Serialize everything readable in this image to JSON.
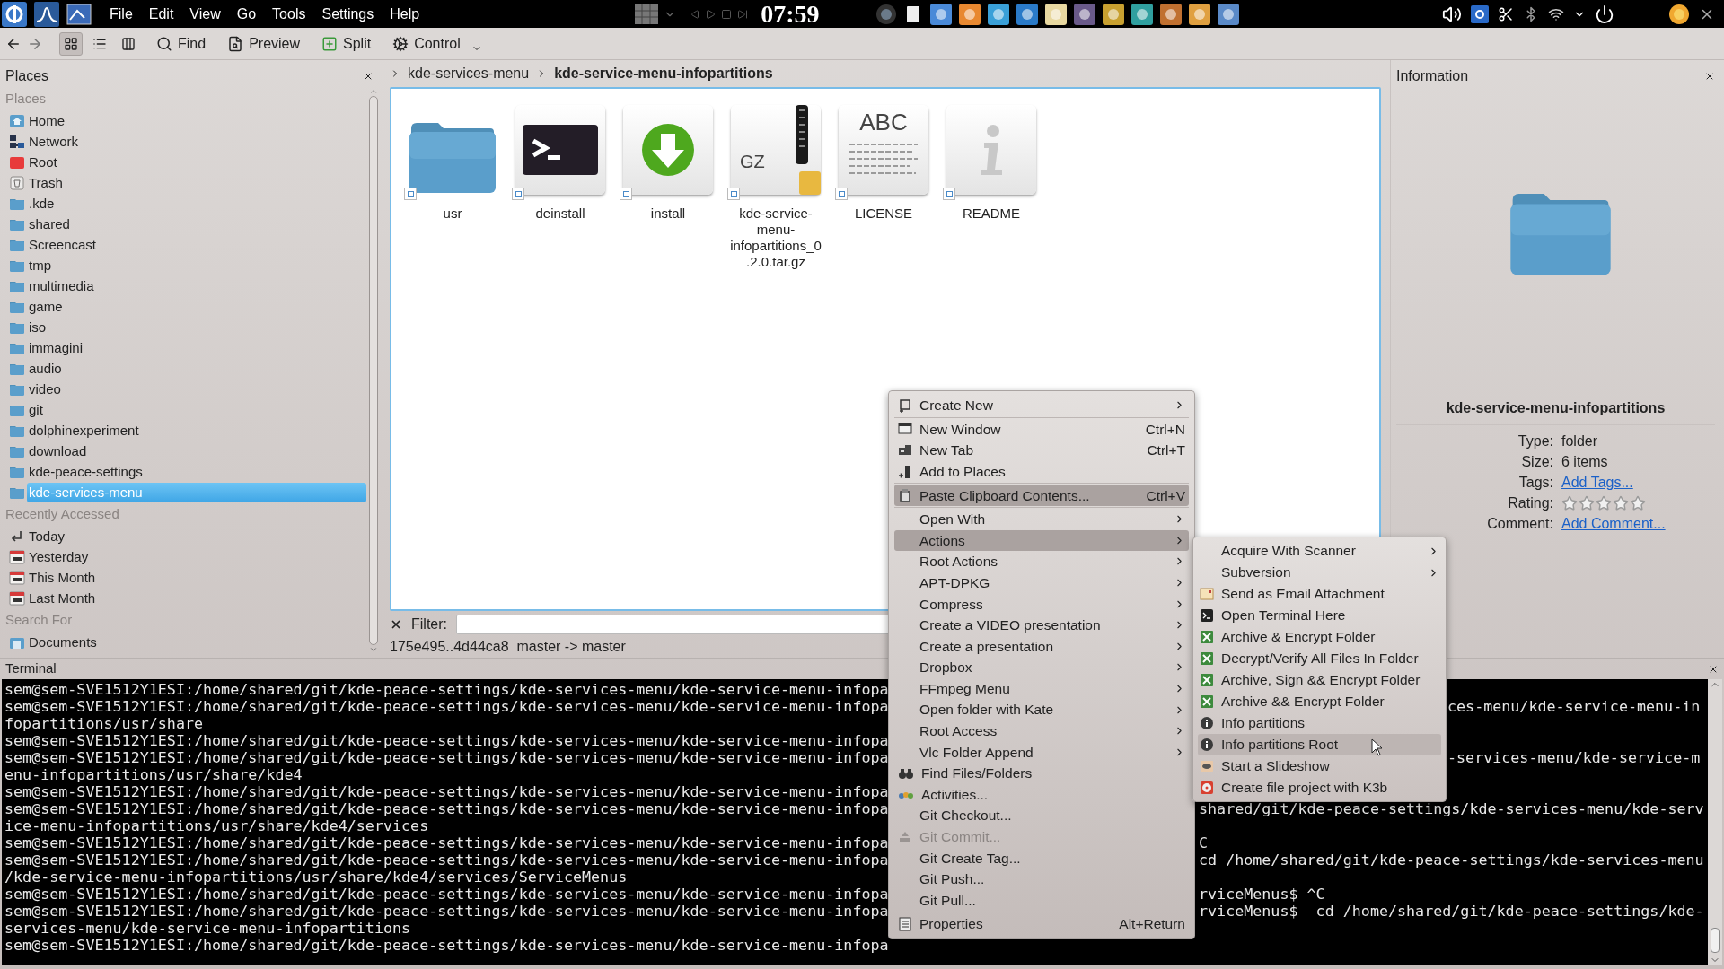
{
  "top_panel": {
    "menu": [
      "File",
      "Edit",
      "View",
      "Go",
      "Tools",
      "Settings",
      "Help"
    ],
    "clock": "07:59"
  },
  "toolbar": {
    "view_modes": [
      {
        "kind": "icons",
        "selected": true
      },
      {
        "kind": "details",
        "selected": false
      },
      {
        "kind": "columns",
        "selected": false
      }
    ],
    "buttons": [
      {
        "kind": "find",
        "label": "Find"
      },
      {
        "kind": "preview",
        "label": "Preview"
      },
      {
        "kind": "split",
        "label": "Split"
      },
      {
        "kind": "control",
        "label": "Control"
      }
    ]
  },
  "places": {
    "title": "Places",
    "sections": [
      {
        "heading": "Places",
        "items": [
          {
            "label": "Home",
            "kind": "home",
            "selected": false
          },
          {
            "label": "Network",
            "kind": "network",
            "selected": false
          },
          {
            "label": "Root",
            "kind": "root",
            "selected": false
          },
          {
            "label": "Trash",
            "kind": "trash",
            "selected": false
          },
          {
            "label": ".kde",
            "kind": "folder",
            "selected": false
          },
          {
            "label": "shared",
            "kind": "folder",
            "selected": false
          },
          {
            "label": "Screencast",
            "kind": "folder",
            "selected": false
          },
          {
            "label": "tmp",
            "kind": "folder",
            "selected": false
          },
          {
            "label": "multimedia",
            "kind": "folder",
            "selected": false
          },
          {
            "label": "game",
            "kind": "folder",
            "selected": false
          },
          {
            "label": "iso",
            "kind": "folder",
            "selected": false
          },
          {
            "label": "immagini",
            "kind": "folder",
            "selected": false
          },
          {
            "label": "audio",
            "kind": "folder",
            "selected": false
          },
          {
            "label": "video",
            "kind": "folder",
            "selected": false
          },
          {
            "label": "git",
            "kind": "folder",
            "selected": false
          },
          {
            "label": "dolphinexperiment",
            "kind": "folder",
            "selected": false
          },
          {
            "label": "download",
            "kind": "folder",
            "selected": false
          },
          {
            "label": "kde-peace-settings",
            "kind": "folder",
            "selected": false
          },
          {
            "label": "kde-services-menu",
            "kind": "folder",
            "selected": true
          }
        ]
      },
      {
        "heading": "Recently Accessed",
        "items": [
          {
            "label": "Today",
            "kind": "back",
            "selected": false
          },
          {
            "label": "Yesterday",
            "kind": "calendar",
            "selected": false
          },
          {
            "label": "This Month",
            "kind": "calendar",
            "selected": false
          },
          {
            "label": "Last Month",
            "kind": "calendar",
            "selected": false
          }
        ]
      },
      {
        "heading": "Search For",
        "items": [
          {
            "label": "Documents",
            "kind": "document",
            "selected": false
          }
        ]
      }
    ]
  },
  "breadcrumb": [
    "kde-services-menu",
    "kde-service-menu-infopartitions"
  ],
  "files": [
    {
      "name": "usr",
      "kind": "folder"
    },
    {
      "name": "deinstall",
      "kind": "script"
    },
    {
      "name": "install",
      "kind": "installer"
    },
    {
      "name": "kde-service-menu-infopartitions_0.2.0.tar.gz",
      "kind": "archive",
      "icon_text": "GZ"
    },
    {
      "name": "LICENSE",
      "kind": "text",
      "icon_text": "ABC"
    },
    {
      "name": "README",
      "kind": "info"
    }
  ],
  "filter": {
    "label": "Filter:"
  },
  "status": "175e495..4d44ca8  master -> master",
  "info": {
    "title": "Information",
    "name": "kde-service-menu-infopartitions",
    "properties": [
      {
        "label": "Type:",
        "kind": "text",
        "value": "folder"
      },
      {
        "label": "Size:",
        "kind": "text",
        "value": "6 items"
      },
      {
        "label": "Tags:",
        "kind": "link",
        "value": "Add Tags..."
      },
      {
        "label": "Rating:",
        "kind": "rating",
        "stars": 0
      },
      {
        "label": "Comment:",
        "kind": "link",
        "value": "Add Comment..."
      }
    ]
  },
  "terminal": {
    "title": "Terminal",
    "lines": [
      {
        "left": "sem@sem-SVE1512Y1ESI:/home/shared/git/kde-peace-settings/kde-services-menu/kde-service-menu-infopa"
      },
      {
        "left": "sem@sem-SVE1512Y1ESI:/home/shared/git/kde-peace-settings/kde-services-menu/kde-service-menu-infopa",
        "right": "ces-menu/kde-service-menu-in"
      },
      {
        "left": "fopartitions/usr/share"
      },
      {
        "left": "sem@sem-SVE1512Y1ESI:/home/shared/git/kde-peace-settings/kde-services-menu/kde-service-menu-infopa"
      },
      {
        "left": "sem@sem-SVE1512Y1ESI:/home/shared/git/kde-peace-settings/kde-services-menu/kde-service-menu-infopa",
        "right": "-services-menu/kde-service-m"
      },
      {
        "left": "enu-infopartitions/usr/share/kde4"
      },
      {
        "left": "sem@sem-SVE1512Y1ESI:/home/shared/git/kde-peace-settings/kde-services-menu/kde-service-menu-infopa"
      },
      {
        "left": "sem@sem-SVE1512Y1ESI:/home/shared/git/kde-peace-settings/kde-services-menu/kde-service-menu-infopa",
        "right": "shared/git/kde-peace-settings/kde-services-menu/kde-serv"
      },
      {
        "left": "ice-menu-infopartitions/usr/share/kde4/services"
      },
      {
        "left": "sem@sem-SVE1512Y1ESI:/home/shared/git/kde-peace-settings/kde-services-menu/kde-service-menu-infopa",
        "right": "C"
      },
      {
        "left": "sem@sem-SVE1512Y1ESI:/home/shared/git/kde-peace-settings/kde-services-menu/kde-service-menu-infopa",
        "right": "cd /home/shared/git/kde-peace-settings/kde-services-menu"
      },
      {
        "left": "/kde-service-menu-infopartitions/usr/share/kde4/services/ServiceMenus"
      },
      {
        "left": "sem@sem-SVE1512Y1ESI:/home/shared/git/kde-peace-settings/kde-services-menu/kde-service-menu-infopa",
        "right": "rviceMenus$ ^C"
      },
      {
        "left": "sem@sem-SVE1512Y1ESI:/home/shared/git/kde-peace-settings/kde-services-menu/kde-service-menu-infopa",
        "right": "rviceMenus$  cd /home/shared/git/kde-peace-settings/kde-"
      },
      {
        "left": "services-menu/kde-service-menu-infopartitions"
      },
      {
        "left": "sem@sem-SVE1512Y1ESI:/home/shared/git/kde-peace-settings/kde-services-menu/kde-service-menu-infopa"
      }
    ]
  },
  "menu": {
    "sections": [
      [
        {
          "label": "Create New",
          "kind": "new",
          "submenu": true,
          "highlighted": false,
          "disabled": false
        }
      ],
      [
        {
          "label": "New Window",
          "kind": "window",
          "shortcut": "Ctrl+N",
          "submenu": false,
          "highlighted": false,
          "disabled": false
        },
        {
          "label": "New Tab",
          "kind": "tab",
          "shortcut": "Ctrl+T",
          "submenu": false,
          "highlighted": false,
          "disabled": false
        },
        {
          "label": "Add to Places",
          "kind": "bookmark",
          "submenu": false,
          "highlighted": false,
          "disabled": false
        }
      ],
      [
        {
          "label": "Paste Clipboard Contents...",
          "kind": "paste",
          "shortcut": "Ctrl+V",
          "submenu": false,
          "highlighted": true,
          "disabled": false
        }
      ],
      [
        {
          "label": "Open With",
          "kind": "none",
          "submenu": true,
          "highlighted": false,
          "disabled": false
        },
        {
          "label": "Actions",
          "kind": "none",
          "submenu": true,
          "highlighted": true,
          "disabled": false
        },
        {
          "label": "Root Actions",
          "kind": "none",
          "submenu": true,
          "highlighted": false,
          "disabled": false
        },
        {
          "label": "APT-DPKG",
          "kind": "none",
          "submenu": true,
          "highlighted": false,
          "disabled": false
        },
        {
          "label": "Compress",
          "kind": "none",
          "submenu": true,
          "highlighted": false,
          "disabled": false
        },
        {
          "label": "Create a VIDEO presentation",
          "kind": "none",
          "submenu": true,
          "highlighted": false,
          "disabled": false
        },
        {
          "label": "Create a presentation",
          "kind": "none",
          "submenu": true,
          "highlighted": false,
          "disabled": false
        },
        {
          "label": "Dropbox",
          "kind": "none",
          "submenu": true,
          "highlighted": false,
          "disabled": false
        },
        {
          "label": "FFmpeg Menu",
          "kind": "none",
          "submenu": true,
          "highlighted": false,
          "disabled": false
        },
        {
          "label": "Open folder with Kate",
          "kind": "none",
          "submenu": true,
          "highlighted": false,
          "disabled": false
        },
        {
          "label": "Root Access",
          "kind": "none",
          "submenu": true,
          "highlighted": false,
          "disabled": false
        },
        {
          "label": "Vlc Folder Append",
          "kind": "none",
          "submenu": true,
          "highlighted": false,
          "disabled": false
        },
        {
          "label": "Find Files/Folders",
          "kind": "binoculars",
          "submenu": false,
          "highlighted": false,
          "disabled": false
        },
        {
          "label": "Activities...",
          "kind": "activities",
          "submenu": false,
          "highlighted": false,
          "disabled": false
        },
        {
          "label": "Git Checkout...",
          "kind": "none",
          "submenu": false,
          "highlighted": false,
          "disabled": false
        },
        {
          "label": "Git Commit...",
          "kind": "commit",
          "submenu": false,
          "highlighted": false,
          "disabled": true
        },
        {
          "label": "Git Create Tag...",
          "kind": "none",
          "submenu": false,
          "highlighted": false,
          "disabled": false
        },
        {
          "label": "Git Push...",
          "kind": "none",
          "submenu": false,
          "highlighted": false,
          "disabled": false
        },
        {
          "label": "Git Pull...",
          "kind": "none",
          "submenu": false,
          "highlighted": false,
          "disabled": false
        }
      ],
      [
        {
          "label": "Properties",
          "kind": "properties",
          "shortcut": "Alt+Return",
          "submenu": false,
          "highlighted": false,
          "disabled": false
        }
      ]
    ]
  },
  "submenu": {
    "items": [
      {
        "label": "Acquire With Scanner",
        "kind": "none",
        "submenu": true,
        "highlighted": false
      },
      {
        "label": "Subversion",
        "kind": "none",
        "submenu": true,
        "highlighted": false
      },
      {
        "label": "Send as Email Attachment",
        "kind": "mail",
        "submenu": false,
        "highlighted": false
      },
      {
        "label": "Open Terminal Here",
        "kind": "terminal",
        "submenu": false,
        "highlighted": false
      },
      {
        "label": "Archive & Encrypt Folder",
        "kind": "key",
        "submenu": false,
        "highlighted": false
      },
      {
        "label": "Decrypt/Verify All Files In Folder",
        "kind": "key",
        "submenu": false,
        "highlighted": false
      },
      {
        "label": "Archive, Sign && Encrypt Folder",
        "kind": "key",
        "submenu": false,
        "highlighted": false
      },
      {
        "label": "Archive && Encrypt Folder",
        "kind": "key",
        "submenu": false,
        "highlighted": false
      },
      {
        "label": "Info partitions",
        "kind": "info",
        "submenu": false,
        "highlighted": false
      },
      {
        "label": "Info partitions Root",
        "kind": "info",
        "submenu": false,
        "highlighted": true
      },
      {
        "label": "Start a Slideshow",
        "kind": "eye",
        "submenu": false,
        "highlighted": false
      },
      {
        "label": "Create file project with K3b",
        "kind": "disc",
        "submenu": false,
        "highlighted": false
      }
    ]
  }
}
